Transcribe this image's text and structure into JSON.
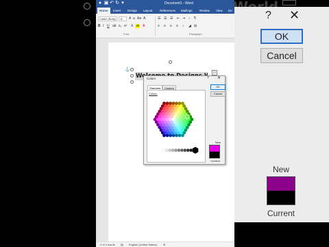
{
  "word": {
    "doc_title": "Document1 - Word",
    "tabs": [
      "Home",
      "Insert",
      "Design",
      "Layout",
      "References",
      "Mailings",
      "Review",
      "View",
      "De"
    ],
    "font_name": "Calibri (Body)",
    "font_size": "11",
    "group_font": "Font",
    "group_paragraph": "Paragraph",
    "heading": "Welcome to Designs World",
    "status_words": "4 of 4 words",
    "status_lang": "English (United States)"
  },
  "colors_dialog": {
    "title": "Colors",
    "help": "?",
    "close": "✕",
    "tab_standard": "Standard",
    "tab_custom": "Custom",
    "colors_label": "Colors:",
    "ok": "OK",
    "cancel": "Cancel",
    "new_label": "New",
    "current_label": "Current",
    "new_color": "#e000e0",
    "current_color": "#000000"
  },
  "zoom": {
    "top_text": "World",
    "help": "?",
    "close": "✕",
    "ok": "OK",
    "cancel": "Cancel",
    "new_label": "New",
    "current_label": "Current"
  }
}
